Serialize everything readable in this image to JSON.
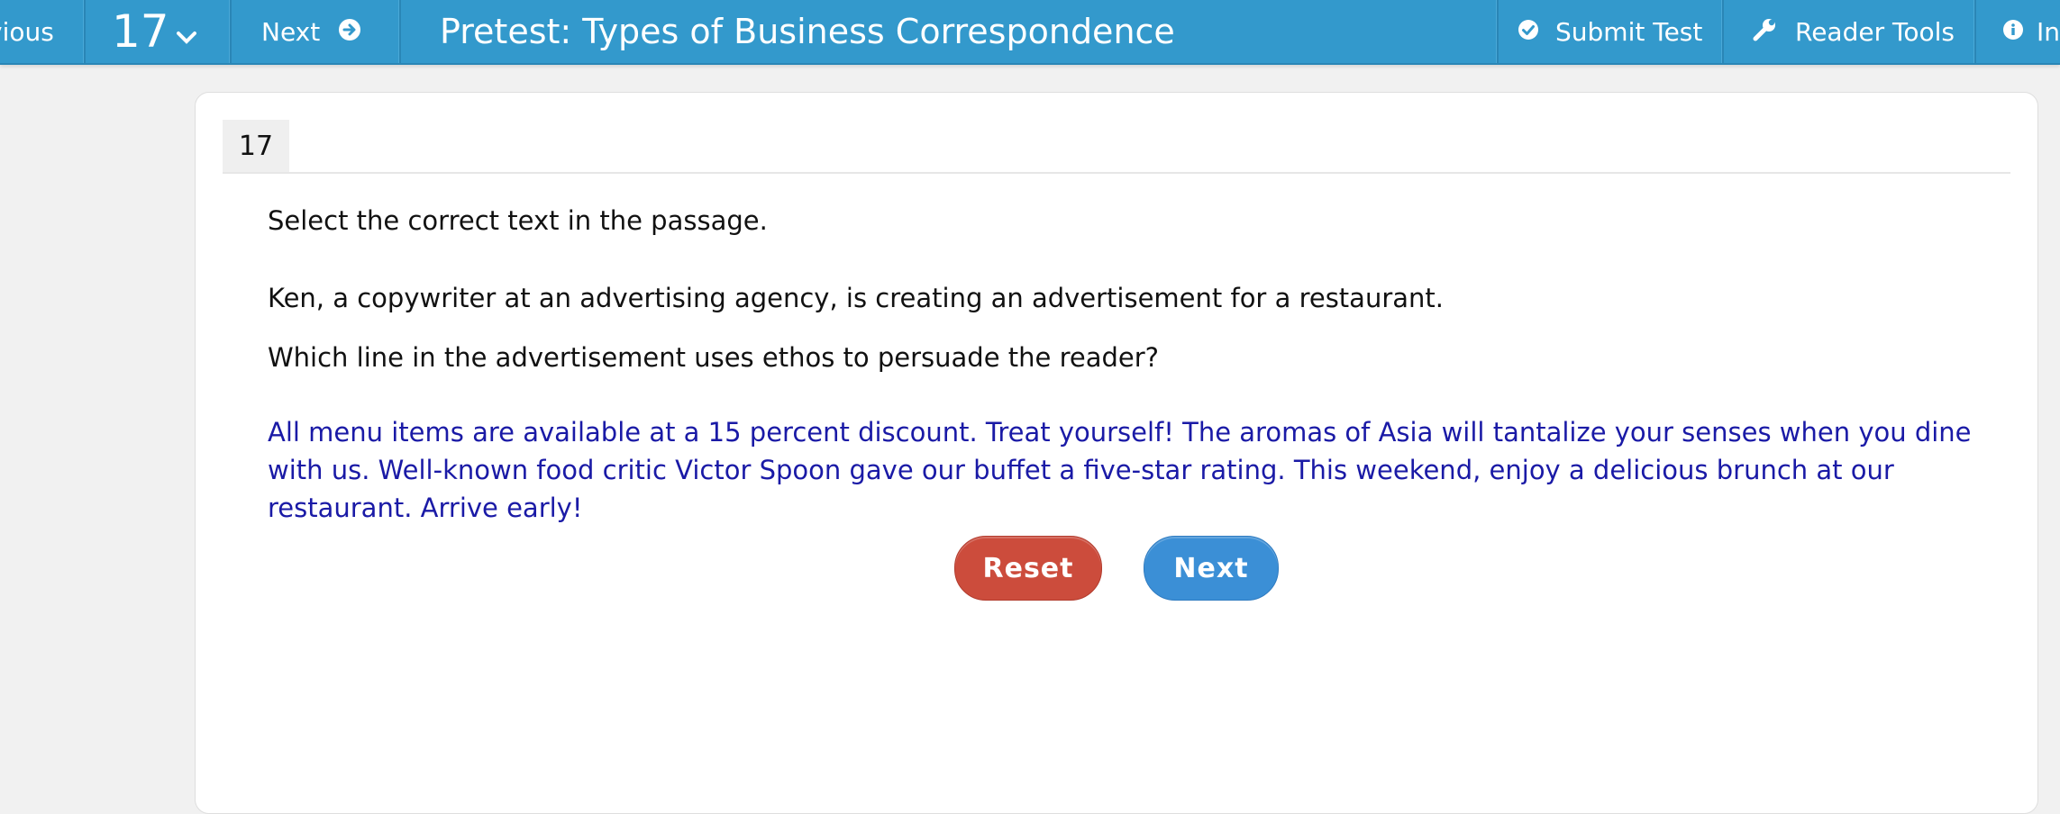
{
  "topbar": {
    "previous_label": "vious",
    "question_number": "17",
    "next_label": "Next",
    "title": "Pretest: Types of Business Correspondence",
    "submit_label": "Submit Test",
    "reader_tools_label": "Reader Tools",
    "info_label": "In"
  },
  "question": {
    "number": "17",
    "instruction": "Select the correct text in the passage.",
    "context": "Ken, a copywriter at an advertising agency, is creating an advertisement for a restaurant.",
    "prompt": "Which line in the advertisement uses ethos to persuade the reader?",
    "passage": [
      " All menu items are available at a 15 percent discount.",
      " Treat yourself!",
      " The aromas of Asia will tantalize your senses when you dine with us.",
      "  Well-known food critic Victor Spoon gave our buffet a five-star rating.",
      "  This weekend, enjoy a delicious brunch at our restaurant.",
      " Arrive early!"
    ]
  },
  "buttons": {
    "reset_label": "Reset",
    "next_label": "Next"
  },
  "colors": {
    "topbar": "#3399cc",
    "passage_text": "#1a1aa6",
    "reset": "#cc4c3c",
    "next": "#3b8fd6"
  }
}
